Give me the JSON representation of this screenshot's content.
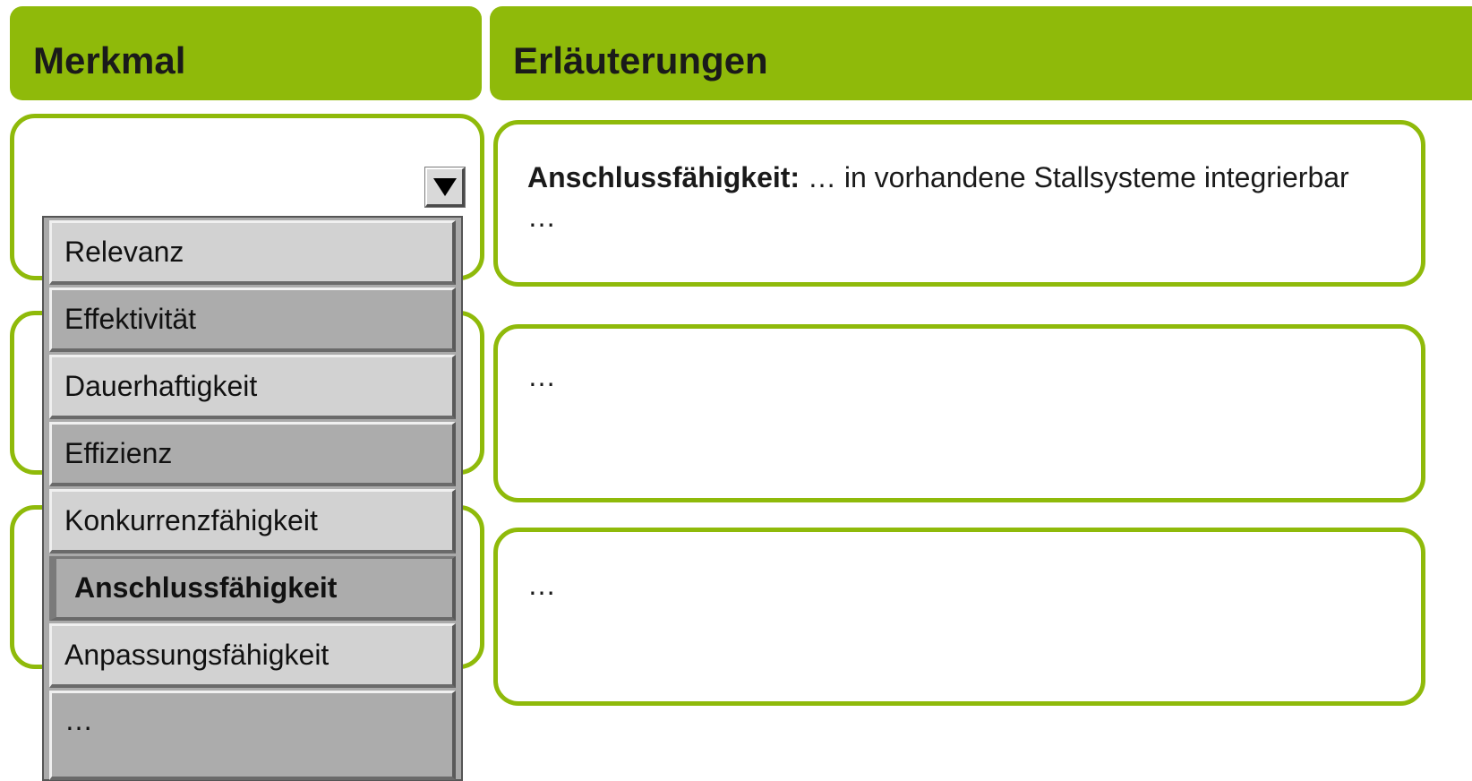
{
  "header": {
    "col1": "Merkmal",
    "col2": "Erläuterungen"
  },
  "rows": [
    {
      "term": "Anschlussfähigkeit:",
      "text": " … in vorhandene Stallsysteme integrierbar …"
    },
    {
      "text": "…"
    },
    {
      "text": "…"
    }
  ],
  "dropdown": {
    "arrow_icon": "triangle-down-icon",
    "items": [
      "Relevanz",
      "Effektivität",
      "Dauerhaftigkeit",
      "Effizienz",
      "Konkurrenzfähigkeit",
      "Anschlussfähigkeit",
      "Anpassungsfähigkeit",
      "…"
    ],
    "selected": "Anschlussfähigkeit"
  },
  "colors": {
    "accent": "#8fba0a",
    "list_light": "#d2d2d2",
    "list_dark": "#acacac"
  }
}
